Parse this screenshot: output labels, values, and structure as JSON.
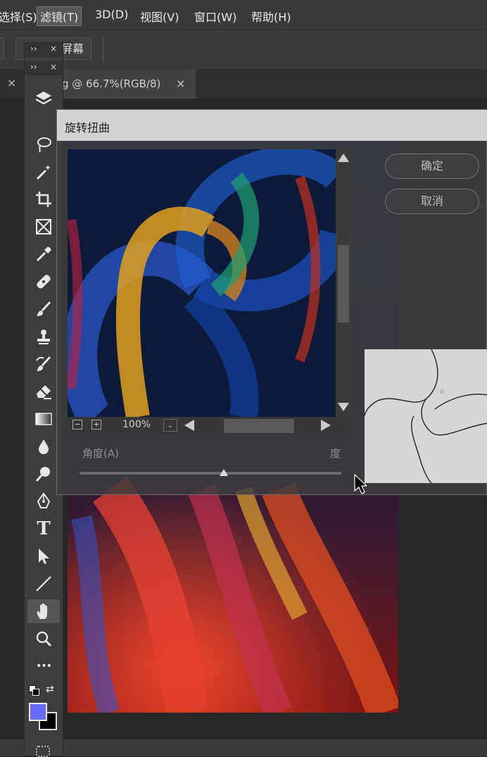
{
  "menu": [
    {
      "label": "选择(S)",
      "active": false
    },
    {
      "label": "滤镜(T)",
      "active": true
    },
    {
      "label": "3D(D)",
      "active": false
    },
    {
      "label": "视图(V)",
      "active": false
    },
    {
      "label": "窗口(W)",
      "active": false
    },
    {
      "label": "帮助(H)",
      "active": false
    }
  ],
  "options_bar": {
    "fill_screen_label": "填充屏幕"
  },
  "tab": {
    "title": "g @ 66.7%(RGB/8)",
    "close": "×",
    "prev_close": "×"
  },
  "toolbox": {
    "collapse_glyph": "››",
    "close_glyph": "×",
    "tools": [
      {
        "name": "layers-panel-icon",
        "glyph": ""
      },
      {
        "name": "lasso-tool-icon",
        "glyph": ""
      },
      {
        "name": "magic-wand-tool-icon",
        "glyph": ""
      },
      {
        "name": "crop-tool-icon",
        "glyph": ""
      },
      {
        "name": "frame-tool-icon",
        "glyph": ""
      },
      {
        "name": "eyedropper-tool-icon",
        "glyph": ""
      },
      {
        "name": "healing-brush-tool-icon",
        "glyph": ""
      },
      {
        "name": "brush-tool-icon",
        "glyph": ""
      },
      {
        "name": "clone-stamp-tool-icon",
        "glyph": ""
      },
      {
        "name": "history-brush-tool-icon",
        "glyph": ""
      },
      {
        "name": "eraser-tool-icon",
        "glyph": ""
      },
      {
        "name": "gradient-tool-icon",
        "glyph": ""
      },
      {
        "name": "blur-tool-icon",
        "glyph": ""
      },
      {
        "name": "dodge-tool-icon",
        "glyph": ""
      },
      {
        "name": "pen-tool-icon",
        "glyph": ""
      },
      {
        "name": "type-tool-icon",
        "glyph": "T"
      },
      {
        "name": "path-selection-tool-icon",
        "glyph": ""
      },
      {
        "name": "line-tool-icon",
        "glyph": ""
      },
      {
        "name": "hand-tool-icon",
        "glyph": ""
      },
      {
        "name": "zoom-tool-icon",
        "glyph": ""
      },
      {
        "name": "more-tools-icon",
        "glyph": "•••"
      }
    ],
    "foreground_color": "#6a6af8",
    "background_color": "#000000"
  },
  "dialog": {
    "title": "旋转扭曲",
    "ok_label": "确定",
    "cancel_label": "取消",
    "zoom_level": "100%",
    "zoom_out_glyph": "−",
    "zoom_in_glyph": "+",
    "angle_label": "角度(A)",
    "angle_unit": "度",
    "angle_slider_fraction": 0.55
  }
}
